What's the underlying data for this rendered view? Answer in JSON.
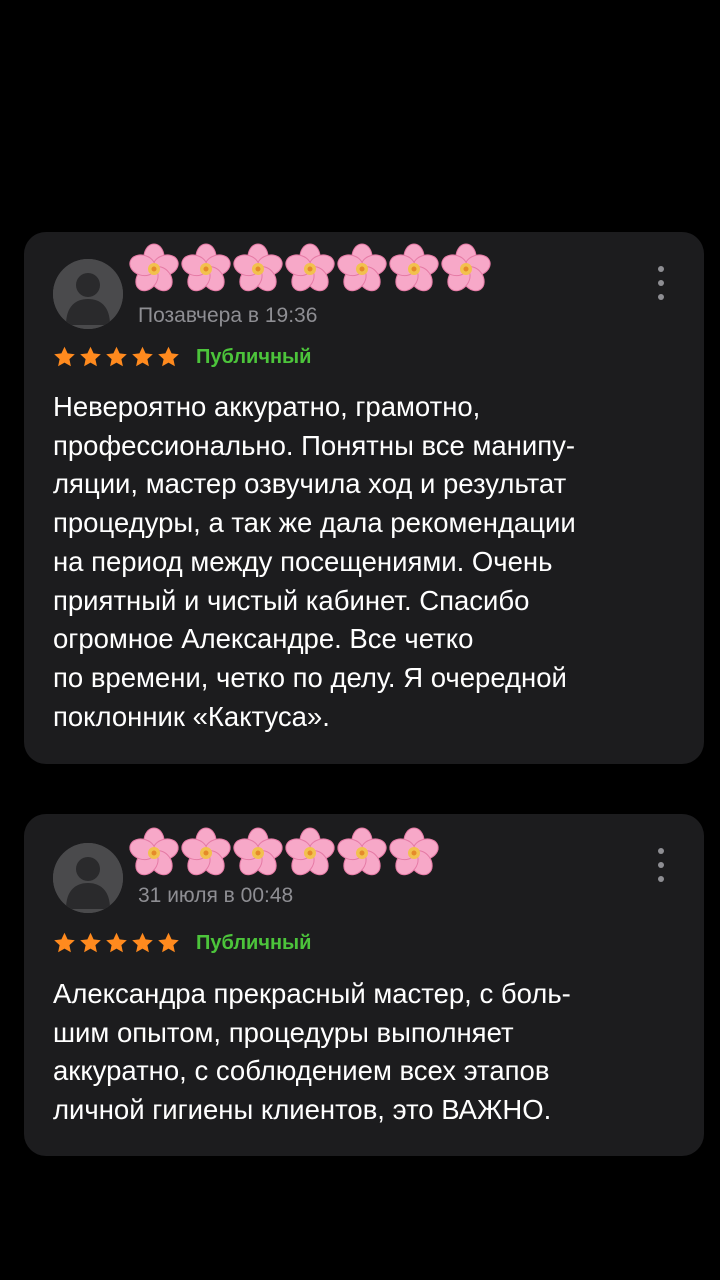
{
  "colors": {
    "background": "#000000",
    "card": "#1c1c1e",
    "star": "#ff8a1e",
    "status": "#4cc43b",
    "date": "#8e8e93",
    "flower": "#f7a8c8"
  },
  "reviews": [
    {
      "author_icons": [
        "flower-icon",
        "flower-icon",
        "flower-icon",
        "flower-icon",
        "flower-icon",
        "flower-icon",
        "flower-icon"
      ],
      "date": "Позавчера в 19:36",
      "rating": 5,
      "status": "Публичный",
      "text_lines": [
        "Невероятно аккуратно, грамотно,",
        "профессионально. Понятны все манипу-",
        "ляции, мастер озвучила ход и результат",
        "процедуры, а так же дала рекомендации",
        "на период между посещениями. Очень",
        "приятный и чистый кабинет. Спасибо",
        "огромное Александре. Все четко",
        "по времени, четко по делу. Я очередной",
        "поклонник «Кактуса»."
      ]
    },
    {
      "author_icons": [
        "flower-icon",
        "flower-icon",
        "flower-icon",
        "flower-icon",
        "flower-icon",
        "flower-icon"
      ],
      "date": "31 июля в 00:48",
      "rating": 5,
      "status": "Публичный",
      "text_lines": [
        "Александра прекрасный мастер, с боль-",
        "шим опытом, процедуры выполняет",
        "аккуратно, с соблюдением всех этапов",
        "личной гигиены клиентов, это ВАЖНО."
      ]
    }
  ]
}
